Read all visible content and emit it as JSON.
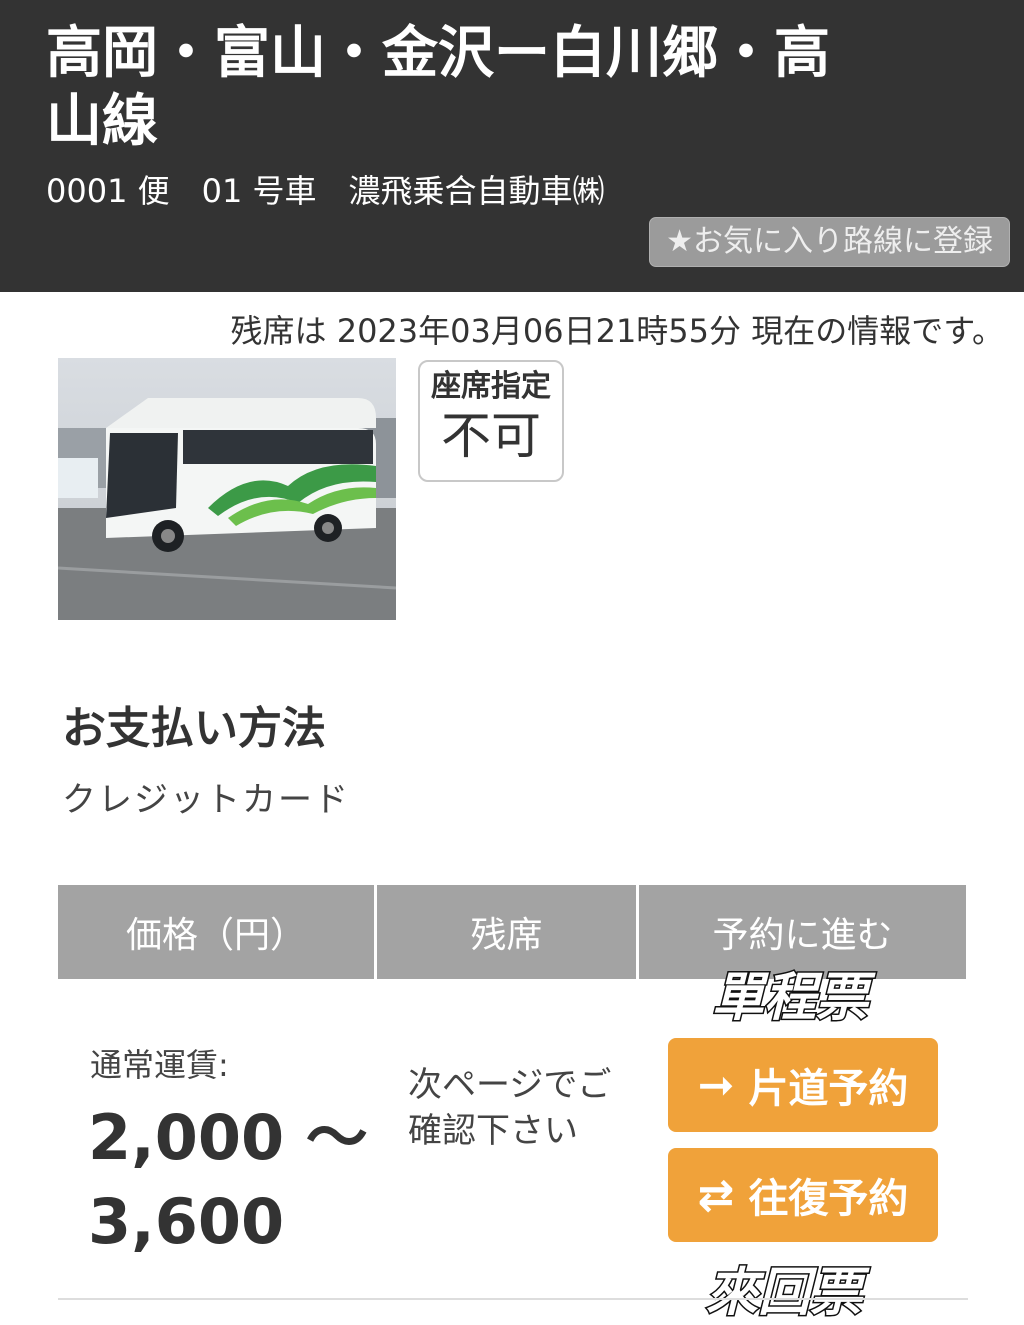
{
  "header": {
    "route_title": "高岡・富山・金沢ー白川郷・高山線",
    "subtitle": "0001 便　01 号車　濃飛乗合自動車㈱",
    "favorite_button": "★お気に入り路線に登録"
  },
  "notice": "残席は 2023年03月06日21時55分 現在の情報です。",
  "seat_designation": {
    "line1": "座席指定",
    "line2": "不可"
  },
  "payment": {
    "title": "お支払い方法",
    "value": "クレジットカード"
  },
  "table": {
    "headers": [
      "価格（円）",
      "残席",
      "予約に進む"
    ],
    "fare_label": "通常運賃:",
    "fare_amount": "2,000 〜 3,600",
    "seat_note": "次ページでご確認下さい",
    "buttons": {
      "one_way": "片道予約",
      "round_trip": "往復予約"
    }
  },
  "annotations": {
    "one_way": "單程票",
    "round_trip": "來回票"
  },
  "colors": {
    "header_bg": "#333333",
    "button": "#f0a23a",
    "table_header": "#a3a3a3"
  }
}
